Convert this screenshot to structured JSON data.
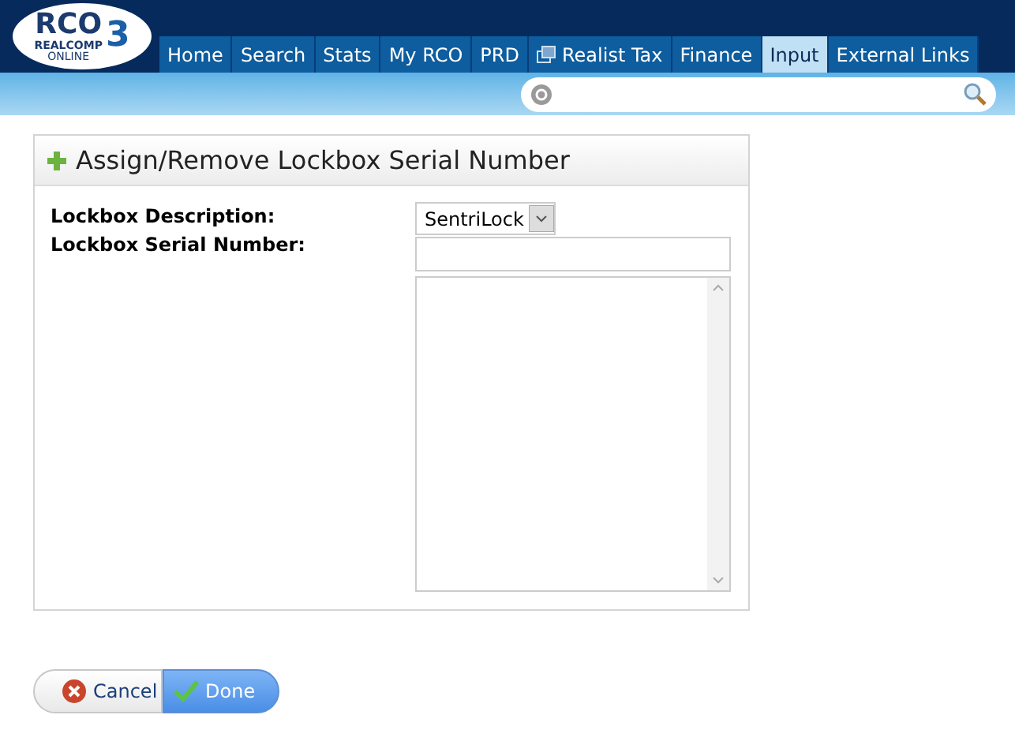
{
  "logo": {
    "main": "RCO",
    "superscript": "3",
    "line_1": "REALCOMP",
    "line_2": "ONLINE"
  },
  "tabs": [
    {
      "label": "Home",
      "selected": false
    },
    {
      "label": "Search",
      "selected": false
    },
    {
      "label": "Stats",
      "selected": false
    },
    {
      "label": "My RCO",
      "selected": false
    },
    {
      "label": "PRD",
      "selected": false
    },
    {
      "label": "Realist Tax",
      "selected": false,
      "kind": "external"
    },
    {
      "label": "Finance",
      "selected": false
    },
    {
      "label": "Input",
      "selected": true
    },
    {
      "label": "External Links",
      "selected": false
    }
  ],
  "panel": {
    "title": "Assign/Remove Lockbox Serial Number",
    "fields": [
      {
        "label": "Lockbox Description:",
        "kind": "select",
        "value": "SentriLock"
      },
      {
        "label": "Lockbox Serial Number:",
        "kind": "text"
      }
    ]
  },
  "buttons": [
    {
      "label": "Cancel",
      "kind": "cancel"
    },
    {
      "label": "Done",
      "kind": "done"
    }
  ]
}
